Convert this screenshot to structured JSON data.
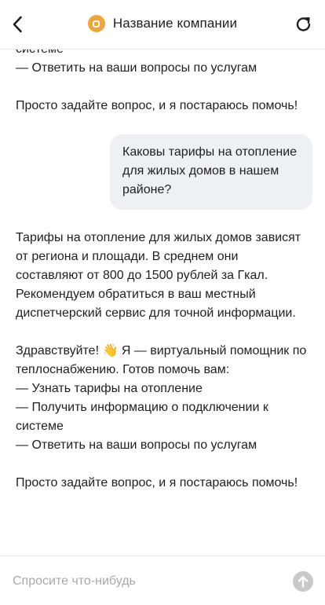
{
  "header": {
    "title": "Название компании",
    "back_icon": "chevron-left-icon",
    "refresh_icon": "refresh-icon",
    "logo_color": "#f0a43c"
  },
  "messages": {
    "top_bot": {
      "line1": "системе",
      "line2": "— Ответить на ваши вопросы по услугам",
      "line3": "Просто задайте вопрос, и я постараюсь помочь!"
    },
    "user": {
      "text": "Каковы тарифы на отопление для жилых домов в нашем районе?"
    },
    "bot_answer": {
      "text": "Тарифы на отопление для жилых домов зависят от региона и площади. В среднем они составляют от 800 до 1500 рублей за Гкал. Рекомендуем обратиться в ваш местный диспетчерский сервис для точной информации."
    },
    "bot_greeting": {
      "hello": "Здравствуйте!",
      "wave": "👋",
      "intro": "Я — виртуальный помощник по теплоснабжению. Готов помочь вам:",
      "item1": "— Узнать тарифы на отопление",
      "item2": "— Получить информацию о подключении к системе",
      "item3": "— Ответить на ваши вопросы по услугам",
      "outro": "Просто задайте вопрос, и я постараюсь помочь!"
    }
  },
  "input": {
    "placeholder": "Спросите что-нибудь",
    "value": ""
  },
  "colors": {
    "accent": "#f0a43c",
    "user_bubble": "#eef1f4",
    "send_button": "#c9c9c9",
    "text": "#1f1f1f",
    "placeholder": "#a8a8a8"
  }
}
